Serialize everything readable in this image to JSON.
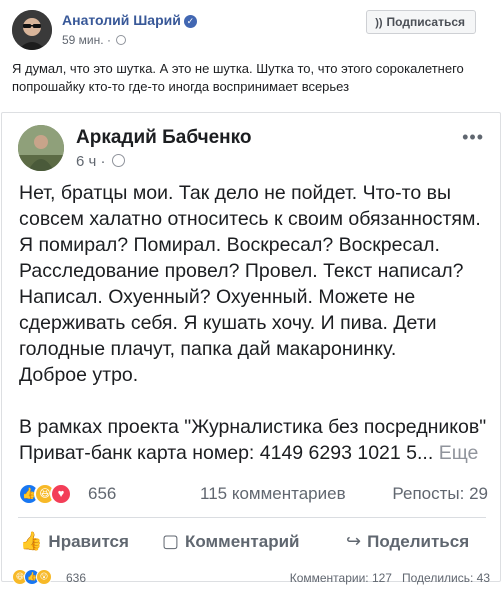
{
  "post": {
    "author": "Анатолий Шарий",
    "time": "59 мин.",
    "subscribe_label": "Подписаться",
    "more": "•••",
    "text": "Я думал, что это шутка. А это не шутка. Шутка то, что этого сорокалетнего попрошайку кто-то где-то иногда воспринимает всерьез"
  },
  "shared": {
    "author": "Аркадий Бабченко",
    "time": "6 ч",
    "more": "•••",
    "text": "Нет, братцы мои. Так дело не пойдет. Что-то вы совсем халатно относитесь к своим обязанностям. Я помирал? Помирал. Воскресал? Воскресал. Расследование провел? Провел. Текст написал? Написал. Охуенный? Охуенный. Можете не сдерживать себя. Я кушать хочу. И пива. Дети голодные плачут, папка дай макаронинку.\nДоброе утро.\n\nВ рамках проекта \"Журналистика без посредников\"\nПриват-банк карта номер: 4149 6293 1021 5...",
    "see_more": "Еще",
    "reactions_count": "656",
    "comments": "115 комментариев",
    "shares": "Репосты: 29",
    "actions": {
      "like": "Нравится",
      "comment": "Комментарий",
      "share": "Поделиться"
    }
  },
  "footer": {
    "reactions_count": "636",
    "comments": "Комментарии: 127",
    "shares": "Поделились: 43"
  },
  "icons": {
    "like": "like-icon",
    "haha": "haha-icon",
    "love": "love-icon",
    "wow": "wow-icon"
  },
  "colors": {
    "link": "#385898",
    "like_blue": "#1877f2",
    "love_red": "#f33e58",
    "emoji_yellow": "#f7b928"
  }
}
